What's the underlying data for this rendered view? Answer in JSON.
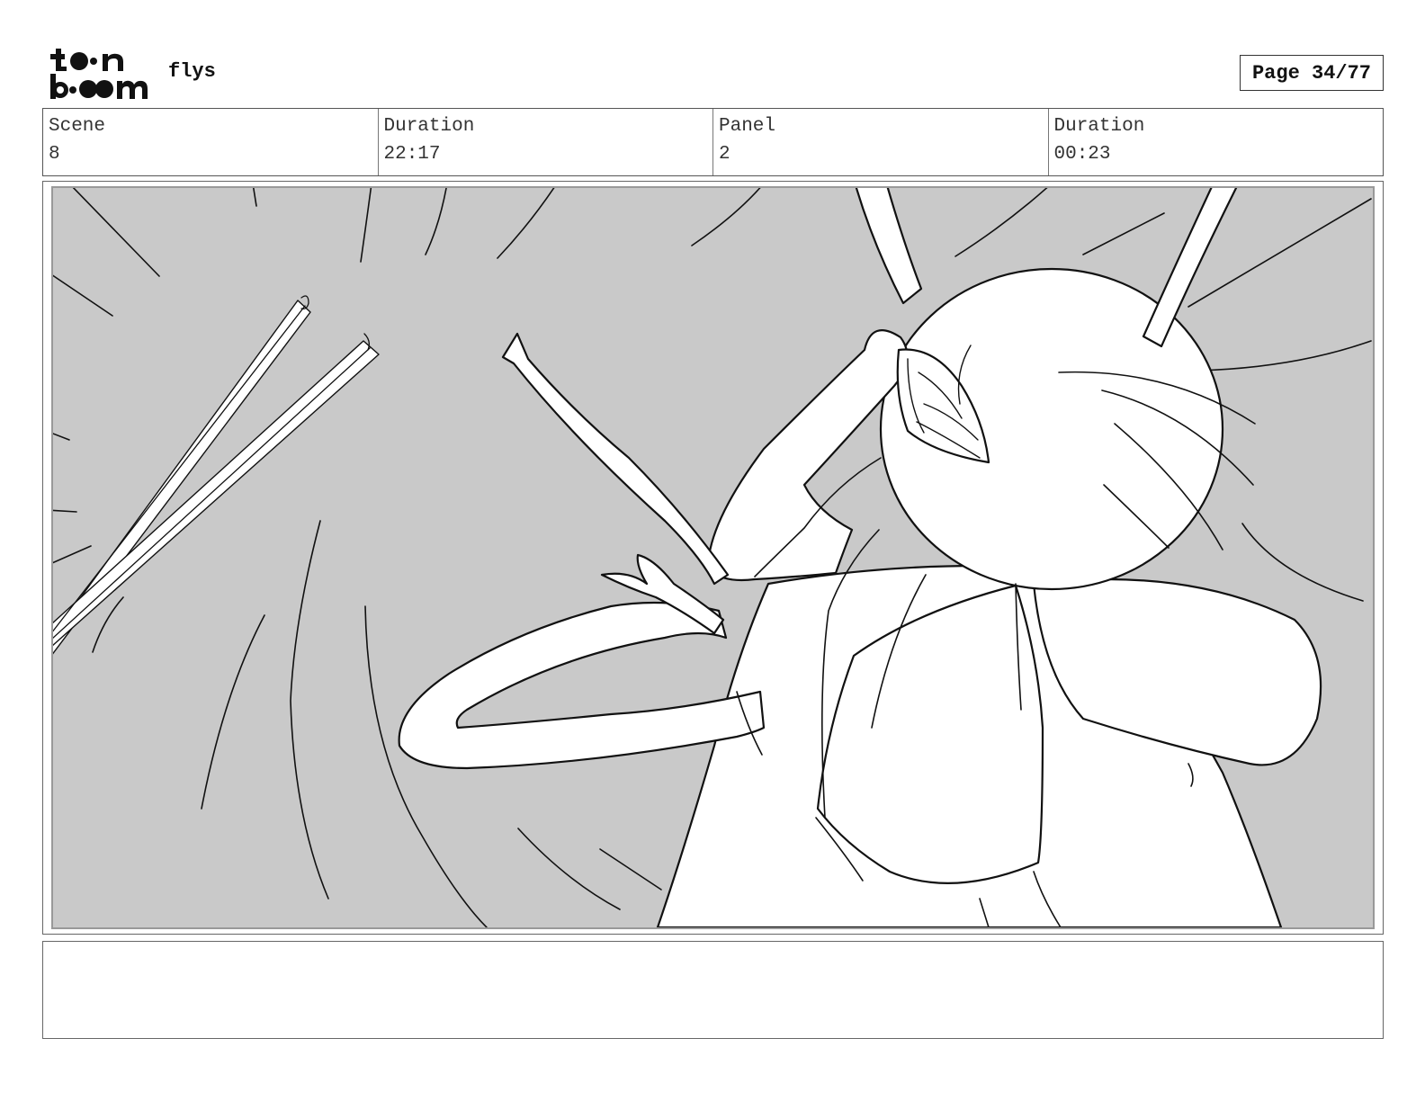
{
  "header": {
    "logo_icon": "toonboom-logo-icon",
    "project_title": "flys",
    "page_label": "Page 34/77"
  },
  "info": {
    "scene_label": "Scene",
    "scene_value": "8",
    "scene_duration_label": "Duration",
    "scene_duration_value": "22:17",
    "panel_label": "Panel",
    "panel_value": "2",
    "panel_duration_label": "Duration",
    "panel_duration_value": "00:23"
  },
  "panel": {
    "background_color": "#c9c9c9",
    "line_color": "#111111"
  },
  "notes": {
    "text": ""
  }
}
